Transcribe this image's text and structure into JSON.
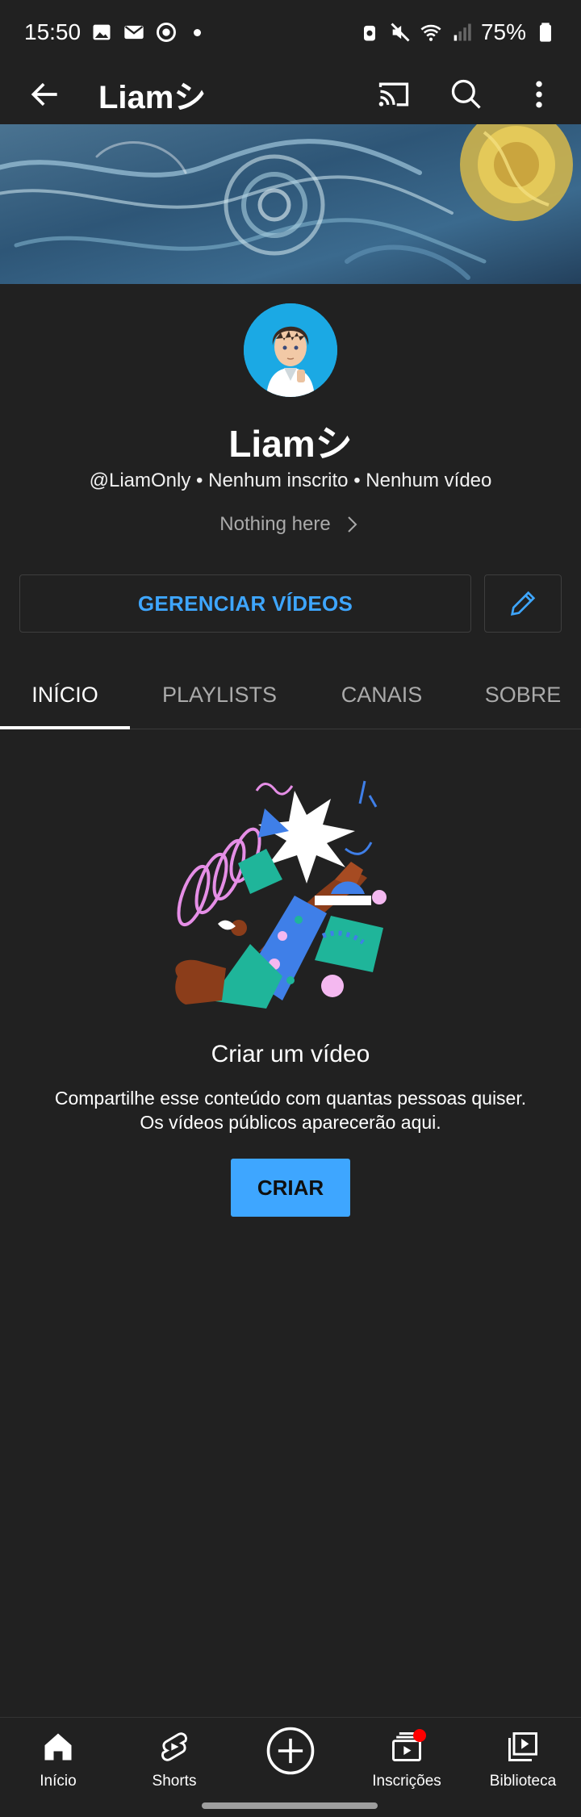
{
  "status_bar": {
    "time": "15:50",
    "battery": "75%",
    "icons": [
      "gallery-icon",
      "mail-icon",
      "recorder-icon",
      "notification-dot",
      "alarm-icon",
      "mute-icon",
      "wifi-icon",
      "signal-icon",
      "battery-icon"
    ]
  },
  "app_bar": {
    "title": "Liamシ",
    "icons": [
      "back-arrow-icon",
      "cast-icon",
      "search-icon",
      "more-vert-icon"
    ]
  },
  "channel": {
    "name": "Liamシ",
    "handle": "@LiamOnly",
    "separator": "•",
    "subscribers": "Nenhum inscrito",
    "videos": "Nenhum vídeo",
    "description": "Nothing here"
  },
  "actions": {
    "manage_videos": "GERENCIAR VÍDEOS",
    "edit_icon": "pencil-icon"
  },
  "tabs": [
    {
      "label": "INÍCIO",
      "active": true
    },
    {
      "label": "PLAYLISTS",
      "active": false
    },
    {
      "label": "CANAIS",
      "active": false
    },
    {
      "label": "SOBRE",
      "active": false
    }
  ],
  "empty_state": {
    "title": "Criar um vídeo",
    "line1": "Compartilhe esse conteúdo com quantas pessoas quiser.",
    "line2": "Os vídeos públicos aparecerão aqui.",
    "button": "CRIAR"
  },
  "bottom_nav": [
    {
      "label": "Início",
      "icon": "home-icon"
    },
    {
      "label": "Shorts",
      "icon": "shorts-icon"
    },
    {
      "label": "",
      "icon": "create-plus-icon"
    },
    {
      "label": "Inscrições",
      "icon": "subscriptions-icon"
    },
    {
      "label": "Biblioteca",
      "icon": "library-icon"
    }
  ],
  "colors": {
    "background": "#212121",
    "accent_blue": "#3ea6ff",
    "notification_red": "#ff0000"
  }
}
